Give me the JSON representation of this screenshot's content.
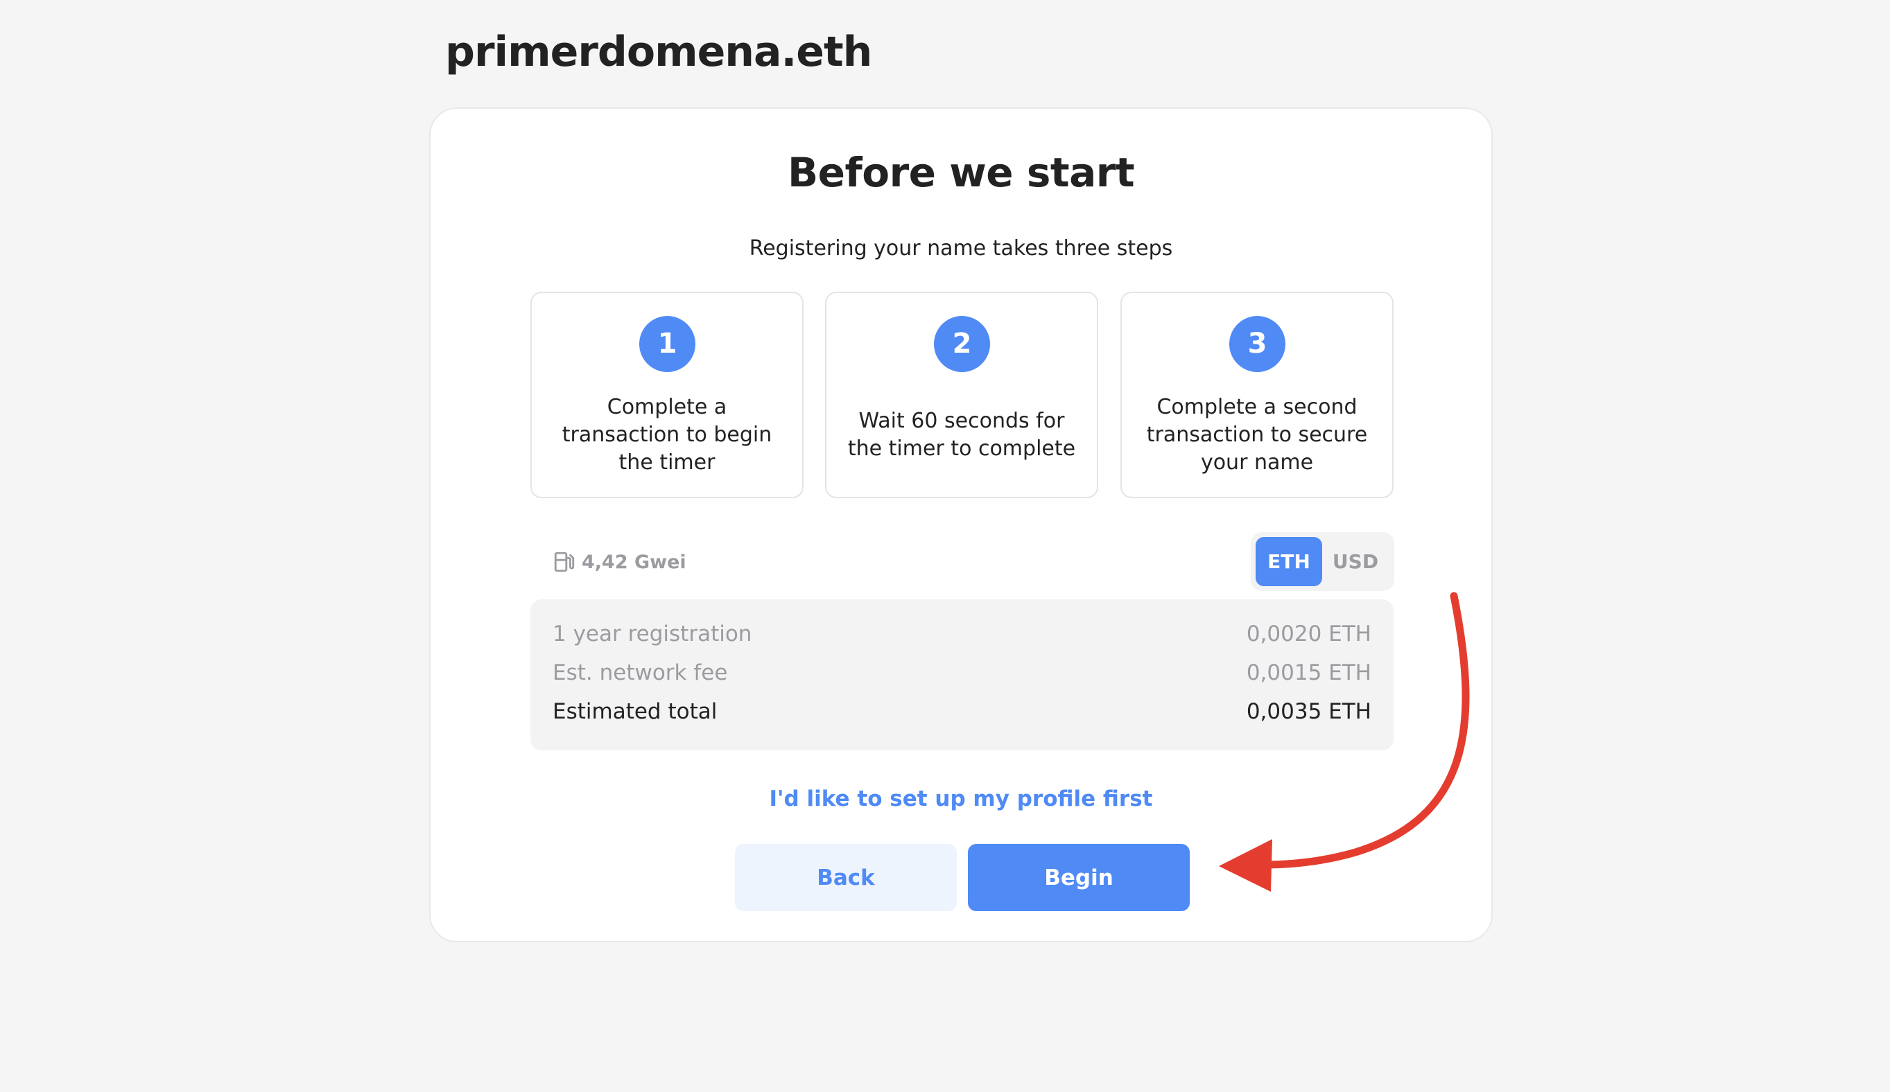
{
  "page": {
    "domain_name": "primerdomena.eth"
  },
  "card": {
    "title": "Before we start",
    "subtitle": "Registering your name takes three steps",
    "steps": [
      {
        "number": "1",
        "text": "Complete a transaction to begin the timer"
      },
      {
        "number": "2",
        "text": "Wait 60 seconds for the timer to complete"
      },
      {
        "number": "3",
        "text": "Complete a second transaction to secure your name"
      }
    ],
    "gas": {
      "icon": "gas-pump-icon",
      "value": "4,42 Gwei"
    },
    "currency_toggle": {
      "options": [
        "ETH",
        "USD"
      ],
      "selected": "ETH"
    },
    "costs": [
      {
        "label": "1 year registration",
        "value": "0,0020 ETH"
      },
      {
        "label": "Est. network fee",
        "value": "0,0015 ETH"
      },
      {
        "label": "Estimated total",
        "value": "0,0035 ETH"
      }
    ],
    "profile_link": "I'd like to set up my profile first",
    "buttons": {
      "back": "Back",
      "begin": "Begin"
    }
  },
  "annotation": {
    "arrow_color": "#e43d2f"
  },
  "colors": {
    "accent": "#4f8af5",
    "accent_light": "#eef4fe",
    "background": "#f5f5f6",
    "muted_text": "#9b9ba0",
    "text": "#222222"
  }
}
